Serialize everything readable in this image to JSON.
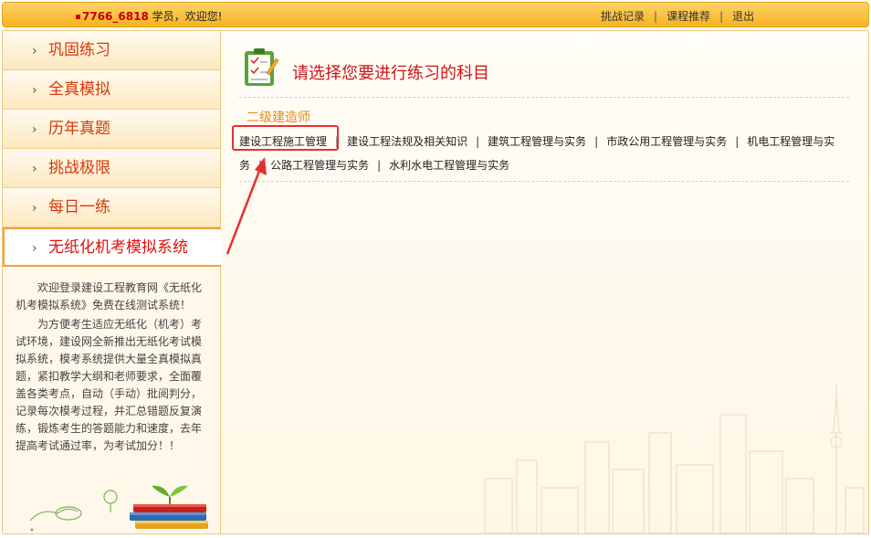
{
  "header": {
    "user_id": "7766_6818",
    "greeting": "学员，欢迎您!",
    "links": [
      "挑战记录",
      "课程推荐",
      "退出"
    ],
    "separator": "|"
  },
  "sidebar": {
    "items": [
      {
        "label": "巩固练习"
      },
      {
        "label": "全真模拟"
      },
      {
        "label": "历年真题"
      },
      {
        "label": "挑战极限"
      },
      {
        "label": "每日一练"
      },
      {
        "label": "无纸化机考模拟系统",
        "active": true
      }
    ],
    "arrow": "›",
    "intro_p1": "欢迎登录建设工程教育网《无纸化机考模拟系统》免费在线测试系统！",
    "intro_p2": "为方便考生适应无纸化（机考）考试环境，建设网全新推出无纸化考试模拟系统，模考系统提供大量全真模拟真题，紧扣教学大纲和老师要求，全面覆盖各类考点，自动（手动）批阅判分，记录每次模考过程，并汇总错题反复演练，锻炼考生的答题能力和速度，去年提高考试通过率，为考试加分！！"
  },
  "main": {
    "title": "请选择您要进行练习的科目",
    "category": "二级建造师",
    "subjects": [
      "建设工程施工管理",
      "建设工程法规及相关知识",
      "建筑工程管理与实务",
      "市政公用工程管理与实务",
      "机电工程管理与实务",
      "公路工程管理与实务",
      "水利水电工程管理与实务"
    ],
    "separator": "|"
  },
  "colors": {
    "header_bg": "#f6b21e",
    "menu_text": "#d8380e",
    "title_text": "#d01414",
    "category_text": "#e88a18",
    "annotation_red": "#e53030"
  },
  "icons": [
    "clipboard-icon",
    "books-icon",
    "city-skyline-illustration"
  ]
}
